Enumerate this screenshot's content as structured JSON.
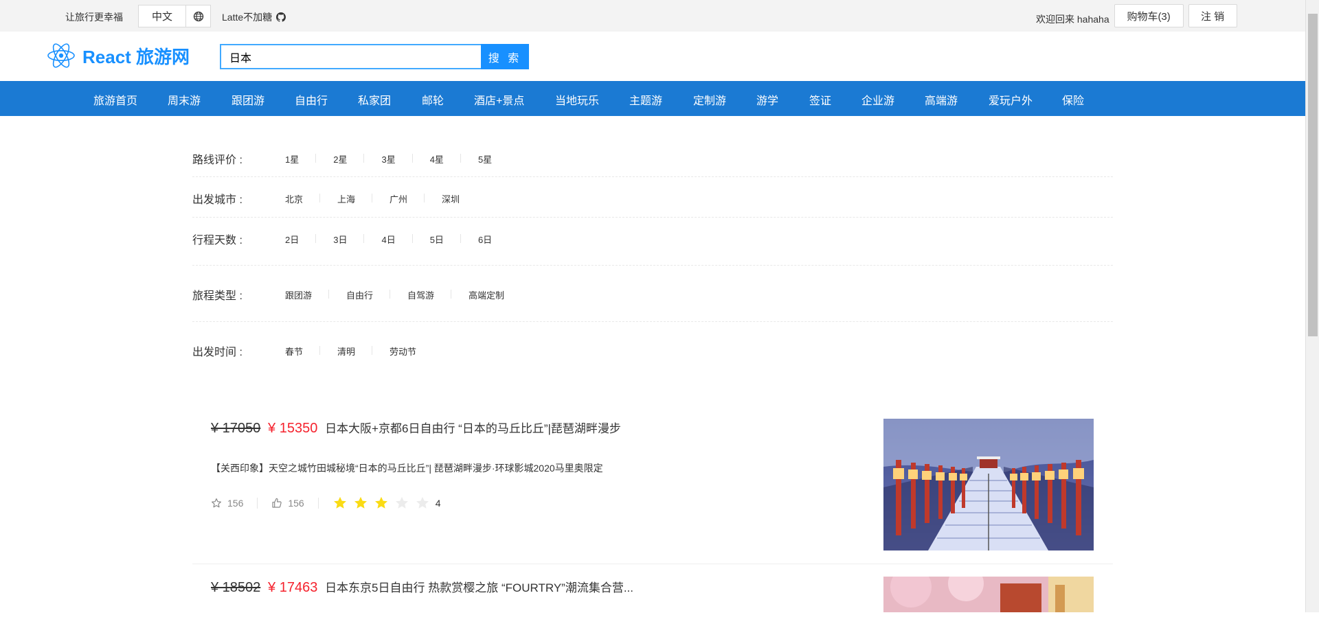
{
  "topbar": {
    "slogan": "让旅行更幸福",
    "language": "中文",
    "author": "Latte不加糖",
    "welcome": "欢迎回来 hahaha",
    "cart": "购物车(3)",
    "logout": "注 销"
  },
  "header": {
    "logo_text": "React 旅游网",
    "search_value": "日本",
    "search_button": "搜 索"
  },
  "nav": [
    "旅游首页",
    "周末游",
    "跟团游",
    "自由行",
    "私家团",
    "邮轮",
    "酒店+景点",
    "当地玩乐",
    "主题游",
    "定制游",
    "游学",
    "签证",
    "企业游",
    "高端游",
    "爱玩户外",
    "保险"
  ],
  "filters": [
    {
      "label": "路线评价 :",
      "options": [
        "1星",
        "2星",
        "3星",
        "4星",
        "5星"
      ]
    },
    {
      "label": "出发城市 :",
      "options": [
        "北京",
        "上海",
        "广州",
        "深圳"
      ]
    },
    {
      "label": "行程天数 :",
      "options": [
        "2日",
        "3日",
        "4日",
        "5日",
        "6日"
      ]
    },
    {
      "label": "旅程类型 :",
      "options": [
        "跟团游",
        "自由行",
        "自驾游",
        "高端定制"
      ]
    },
    {
      "label": "出发时间 :",
      "options": [
        "春节",
        "清明",
        "劳动节"
      ]
    }
  ],
  "products": [
    {
      "original_price": "¥ 17050",
      "price": "¥ 15350",
      "title": "日本大阪+京都6日自由行 “日本的马丘比丘”|琵琶湖畔漫步",
      "description": "【关西印象】天空之城竹田城秘境“日本的马丘比丘”| 琵琶湖畔漫步·环球影城2020马里奥限定",
      "favorites": "156",
      "likes": "156",
      "rating": 3,
      "rating_label": "4"
    },
    {
      "original_price": "¥ 18502",
      "price": "¥ 17463",
      "title": "日本东京5日自由行 热款赏樱之旅 “FOURTRY”潮流集合营..."
    }
  ],
  "colors": {
    "brand": "#1890ff",
    "nav": "#1b7ad3",
    "price": "#f5222d",
    "star": "#fadb14"
  }
}
